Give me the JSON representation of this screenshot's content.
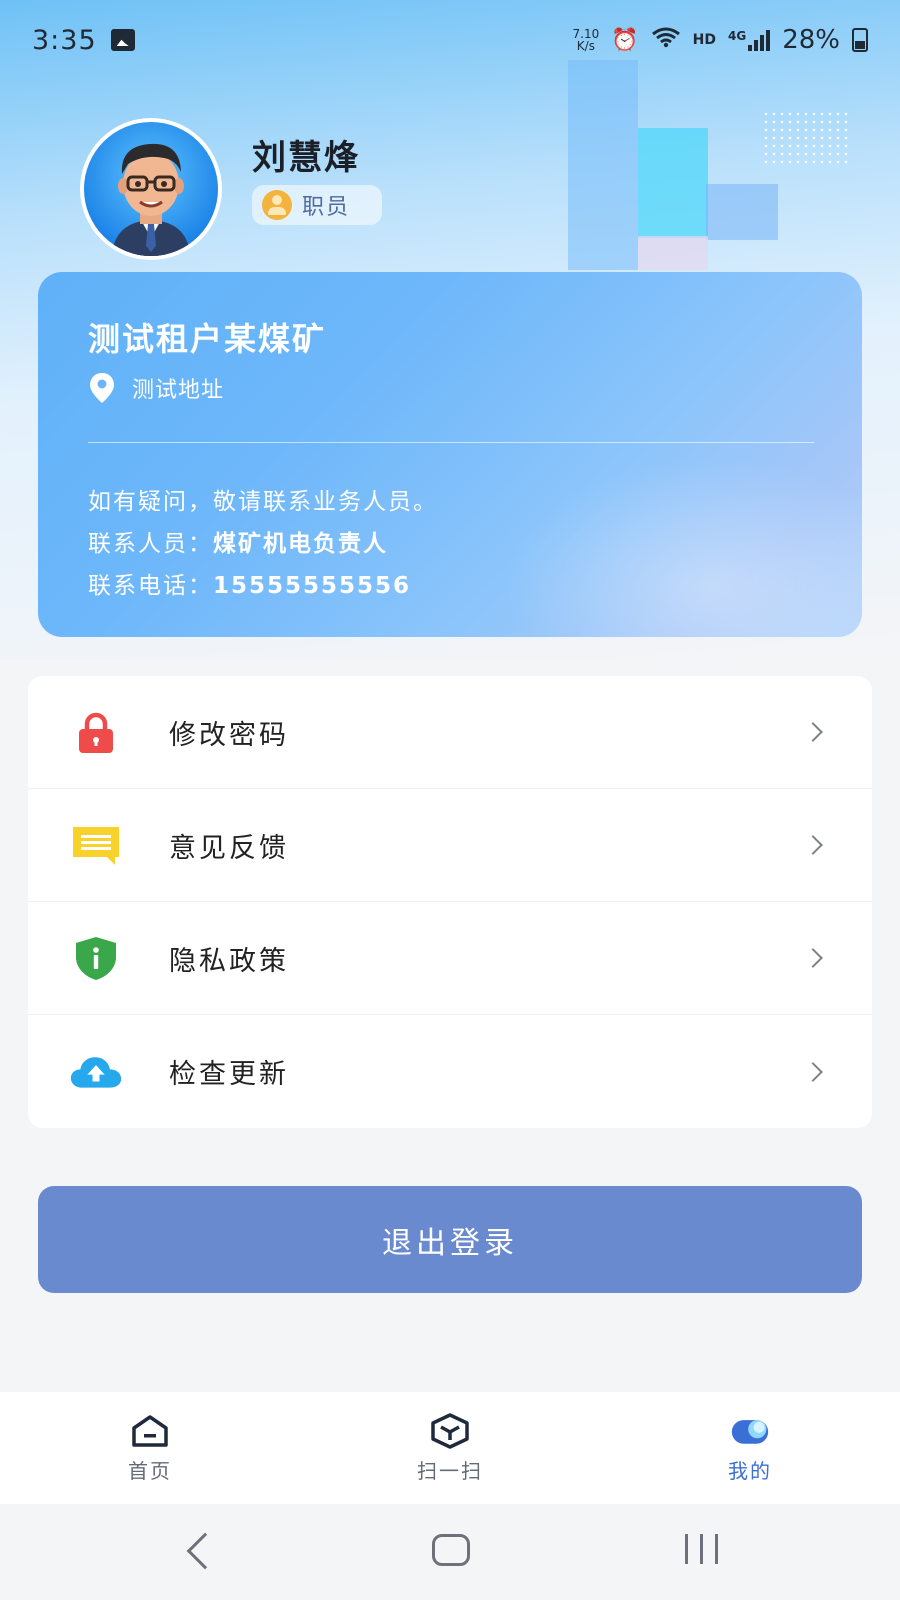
{
  "status_bar": {
    "time": "3:35",
    "net_speed_value": "7.10",
    "net_speed_unit": "K/s",
    "network_label": "HD",
    "network_type": "4G",
    "battery": "28%"
  },
  "profile": {
    "name": "刘慧烽",
    "role": "职员"
  },
  "company": {
    "name": "测试租户某煤矿",
    "address": "测试地址",
    "notice": "如有疑问，敬请联系业务人员。",
    "contact_label": "联系人员：",
    "contact_value": "煤矿机电负责人",
    "phone_label": "联系电话：",
    "phone_value": "15555555556"
  },
  "menu": {
    "items": [
      {
        "label": "修改密码",
        "icon": "lock-icon",
        "color": "#f04b4b"
      },
      {
        "label": "意见反馈",
        "icon": "message-icon",
        "color": "#f8d12a"
      },
      {
        "label": "隐私政策",
        "icon": "shield-info-icon",
        "color": "#3aa84a"
      },
      {
        "label": "检查更新",
        "icon": "cloud-upload-icon",
        "color": "#26a8ec"
      }
    ]
  },
  "logout_label": "退出登录",
  "bottom_nav": {
    "items": [
      {
        "label": "首页",
        "icon": "home-icon",
        "active": false
      },
      {
        "label": "扫一扫",
        "icon": "scan-cube-icon",
        "active": false
      },
      {
        "label": "我的",
        "icon": "profile-toggle-icon",
        "active": true
      }
    ]
  },
  "colors": {
    "accent": "#3b6fd6",
    "logout_button": "#6a8ad0",
    "card_gradient_start": "#5fb1f8",
    "card_gradient_end": "#b7d6fb"
  }
}
